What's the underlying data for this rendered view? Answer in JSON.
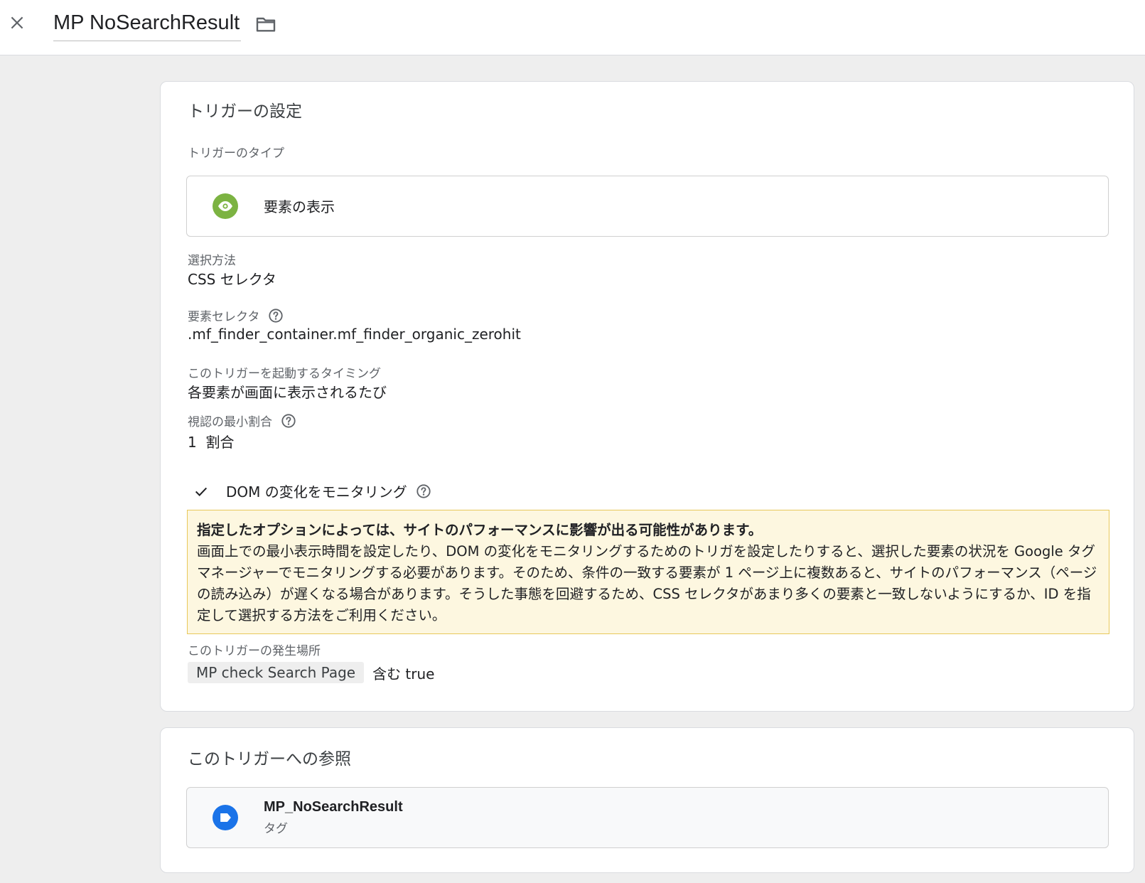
{
  "header": {
    "title": "MP NoSearchResult",
    "close_icon": "close-icon",
    "folder_icon": "folder-icon"
  },
  "trigger_config": {
    "heading": "トリガーの設定",
    "type_label": "トリガーのタイプ",
    "type_name": "要素の表示",
    "type_icon": "eye-icon",
    "type_icon_color": "#7cb342",
    "selection_method_label": "選択方法",
    "selection_method_value": "CSS セレクタ",
    "element_selector_label": "要素セレクタ",
    "element_selector_value": ".mf_finder_container.mf_finder_organic_zerohit",
    "timing_label": "このトリガーを起動するタイミング",
    "timing_value": "各要素が画面に表示されるたび",
    "min_visible_label": "視認の最小割合",
    "min_visible_value": "1  割合",
    "dom_check_label": "DOM の変化をモニタリング",
    "dom_check_checked": true,
    "warning": {
      "title": "指定したオプションによっては、サイトのパフォーマンスに影響が出る可能性があります。",
      "body": "画面上での最小表示時間を設定したり、DOM の変化をモニタリングするためのトリガを設定したりすると、選択した要素の状況を Google タグ マネージャーでモニタリングする必要があります。そのため、条件の一致する要素が 1 ページ上に複数あると、サイトのパフォーマンス（ページの読み込み）が遅くなる場合があります。そうした事態を回避するため、CSS セレクタがあまり多くの要素と一致しないようにするか、ID を指定して選択する方法をご利用ください。"
    },
    "fires_on_label": "このトリガーの発生場所",
    "fires_on_variable": "MP check Search Page",
    "fires_on_condition": "含む true"
  },
  "references": {
    "heading": "このトリガーへの参照",
    "items": [
      {
        "name": "MP_NoSearchResult",
        "kind": "タグ",
        "icon": "tag-icon",
        "icon_color": "#1a73e8"
      }
    ]
  },
  "colors": {
    "accent_green": "#7cb342",
    "accent_blue": "#1a73e8",
    "warning_bg": "#fdf7e0",
    "warning_border": "#e8c85a"
  }
}
